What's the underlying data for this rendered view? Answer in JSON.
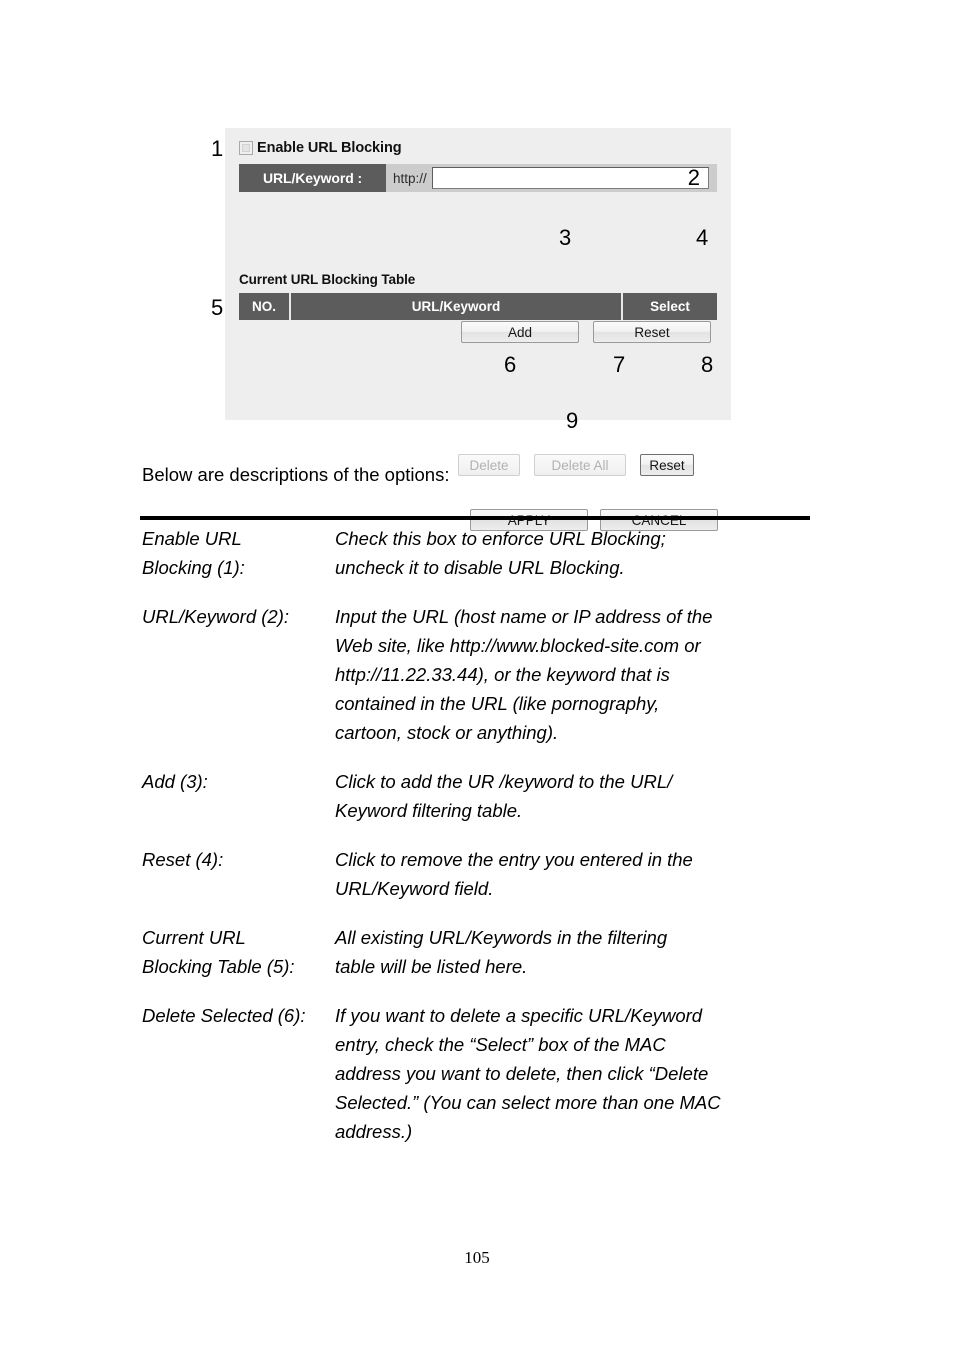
{
  "figure": {
    "panel": {
      "enable_checkbox": {
        "label": "Enable URL Blocking",
        "checked": false
      },
      "url_field": {
        "label": "URL/Keyword :",
        "protocol_prefix": "http://",
        "value": "",
        "placeholder": ""
      },
      "add_button": "Add",
      "reset_button": "Reset",
      "table_title": "Current URL Blocking Table",
      "table_headers": [
        "NO.",
        "URL/Keyword",
        "Select"
      ],
      "table_rows": [],
      "delete_button": "Delete",
      "delete_all_button": "Delete All",
      "table_reset_button": "Reset",
      "apply_button": "APPLY",
      "cancel_button": "CANCEL"
    },
    "callouts": {
      "c1": "1",
      "c2": "2",
      "c3": "3",
      "c4": "4",
      "c5": "5",
      "c6": "6",
      "c7": "7",
      "c8": "8",
      "c9": "9"
    }
  },
  "document": {
    "intro": "Below are descriptions of the options:",
    "definitions": [
      {
        "term": "Enable URL\nBlocking (1):",
        "desc": "Check this box to enforce URL Blocking;\nuncheck it to disable URL Blocking."
      },
      {
        "term": "URL/Keyword (2):",
        "desc": "Input the URL (host name or IP address of the\nWeb site, like http://www.blocked-site.com or\nhttp://11.22.33.44), or the keyword that is\ncontained in the URL (like pornography,\ncartoon, stock or anything)."
      },
      {
        "term": "Add (3):",
        "desc": "Click to add the UR /keyword to the URL/\nKeyword filtering table."
      },
      {
        "term": "Reset (4):",
        "desc": "Click to remove the entry you entered in the\nURL/Keyword field."
      },
      {
        "term": "Current URL\nBlocking Table (5):",
        "desc": "All existing URL/Keywords in the filtering\ntable will be listed here."
      },
      {
        "term": "Delete Selected (6):",
        "desc": "If you want to delete a specific URL/Keyword\nentry, check the “Select” box of the MAC\naddress you want to delete, then click “Delete\nSelected.” (You can select more than one MAC\naddress.)"
      }
    ],
    "page_number": "105"
  },
  "colors": {
    "panel_background": "#eeeeee",
    "header_dark": "#5c5c5c",
    "field_strip": "#cccccc",
    "text": "#000000"
  }
}
